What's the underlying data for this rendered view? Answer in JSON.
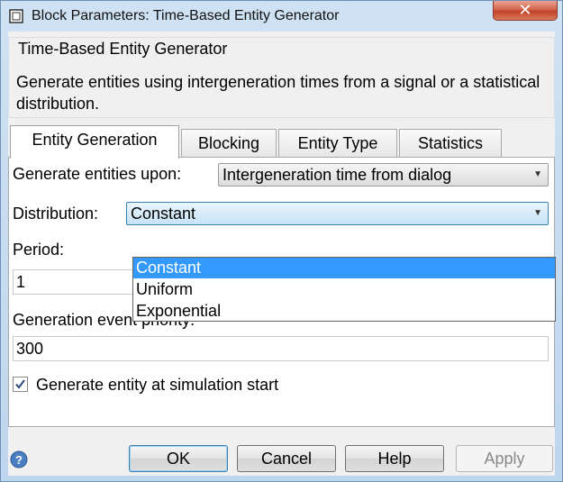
{
  "window": {
    "title": "Block Parameters: Time-Based Entity Generator",
    "close_glyph": "✕"
  },
  "header": {
    "title": "Time-Based Entity Generator",
    "description": "Generate entities using intergeneration times from a signal or a statistical distribution."
  },
  "tabs": [
    {
      "label": "Entity Generation",
      "active": true
    },
    {
      "label": "Blocking",
      "active": false
    },
    {
      "label": "Entity Type",
      "active": false
    },
    {
      "label": "Statistics",
      "active": false
    }
  ],
  "form": {
    "generate_upon_label": "Generate entities upon:",
    "generate_upon_value": "Intergeneration time from dialog",
    "distribution_label": "Distribution:",
    "distribution_value": "Constant",
    "distribution_options": [
      "Constant",
      "Uniform",
      "Exponential"
    ],
    "period_label": "Period:",
    "period_value": "1",
    "priority_label": "Generation event priority:",
    "priority_value": "300",
    "checkbox_label": "Generate entity at simulation start",
    "checkbox_checked": true
  },
  "buttons": {
    "ok": "OK",
    "cancel": "Cancel",
    "help": "Help",
    "apply": "Apply"
  },
  "colors": {
    "selection": "#3399ff",
    "focus_border": "#3c7fb1"
  }
}
